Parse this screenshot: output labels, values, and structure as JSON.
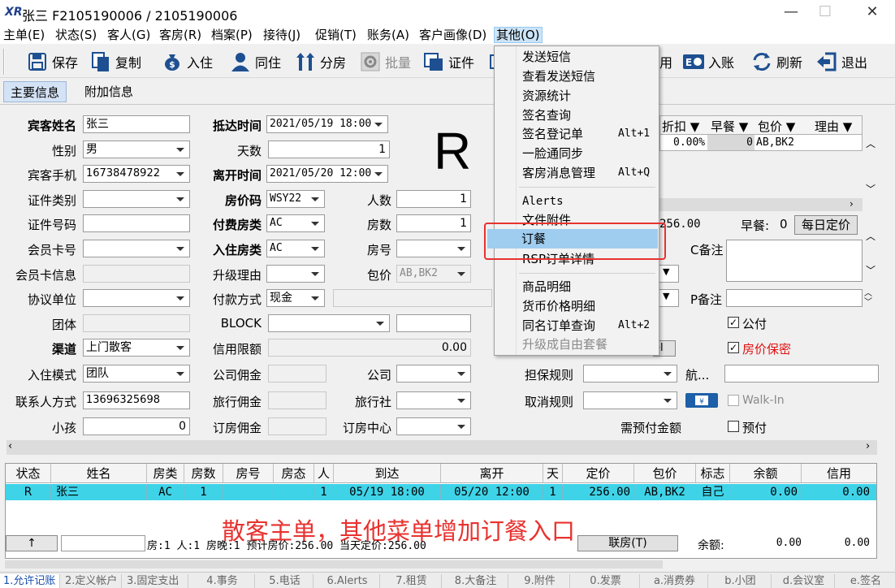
{
  "window": {
    "logo": "XR",
    "title": "张三  F2105190006 / 2105190006",
    "min": "—",
    "max": "☐",
    "close": "✕"
  },
  "menu": [
    "主单(E)",
    "状态(S)",
    "客人(G)",
    "客房(R)",
    "档案(P)",
    "接待(J)",
    "促销(T)",
    "账务(A)",
    "客户画像(D)",
    "其他(O)"
  ],
  "toolbar": {
    "save": "保存",
    "copy": "复制",
    "checkin": "入住",
    "cohabit": "同住",
    "split_room": "分房",
    "batch": "批量",
    "certificate": "证件",
    "post": "用",
    "post_account": "入账",
    "refresh": "刷新",
    "exit": "退出"
  },
  "tabs": {
    "main": "主要信息",
    "extra": "附加信息"
  },
  "status_letter": "R",
  "form": {
    "guest_name_label": "宾客姓名",
    "guest_name": "张三",
    "gender_label": "性别",
    "gender": "男",
    "mobile_label": "宾客手机",
    "mobile": "16738478922",
    "id_type_label": "证件类别",
    "id_type": "",
    "id_no_label": "证件号码",
    "id_no": "",
    "member_card_label": "会员卡号",
    "member_card": "",
    "member_info_label": "会员卡信息",
    "agreement_label": "协议单位",
    "group_label": "团体",
    "channel_label": "渠道",
    "channel": "上门散客",
    "checkin_mode_label": "入住模式",
    "checkin_mode": "团队",
    "contact_label": "联系人方式",
    "contact": "13696325698",
    "child_label": "小孩",
    "child": "0",
    "arrival_label": "抵达时间",
    "arrival": "2021/05/19 18:00",
    "nights_label": "天数",
    "nights": "1",
    "departure_label": "离开时间",
    "departure": "2021/05/20 12:00",
    "rate_code_label": "房价码",
    "rate_code": "WSY22",
    "paid_type_label": "付费房类",
    "paid_type": "AC",
    "room_type_label": "入住房类",
    "room_type": "AC",
    "upgrade_label": "升级理由",
    "pay_method_label": "付款方式",
    "pay_method": "现金",
    "block_label": "BLOCK",
    "credit_label": "信用限额",
    "credit": "0.00",
    "company_comm_label": "公司佣金",
    "agency_comm_label": "旅行佣金",
    "booking_comm_label": "订房佣金",
    "persons_label": "人数",
    "persons": "1",
    "rooms_label": "房数",
    "rooms": "1",
    "room_no_label": "房号",
    "package_label": "包价",
    "package": "AB,BK2",
    "company_label": "公司",
    "agency_label": "旅行社",
    "booking_center_label": "订房中心"
  },
  "right_panel": {
    "cols": [
      "折扣",
      "早餐",
      "包价",
      "理由"
    ],
    "discount": "0.00%",
    "breakfast": "0",
    "package": "AB,BK2",
    "price": "256.00",
    "breakfast_label": "早餐:",
    "breakfast_value": "0",
    "daily_rate_button": "每日定价",
    "c_note_label": "C备注",
    "p_note_label": "P备注",
    "public_label": "公付",
    "price_secret_label": "房价保密",
    "guarantee_label": "担保规则",
    "flight_label": "航...",
    "cancel_label": "取消规则",
    "walkin_label": "Walk-In",
    "deposit_label": "需预付金额",
    "prepay_label": "预付",
    "el_fragment": "el"
  },
  "dropdown": {
    "items": [
      {
        "label": "发送短信",
        "shortcut": ""
      },
      {
        "label": "查看发送短信",
        "shortcut": ""
      },
      {
        "label": "资源统计",
        "shortcut": ""
      },
      {
        "label": "签名查询",
        "shortcut": ""
      },
      {
        "label": "签名登记单",
        "shortcut": "Alt+1"
      },
      {
        "label": "一脸通同步",
        "shortcut": ""
      },
      {
        "label": "客房消息管理",
        "shortcut": "Alt+Q"
      },
      {
        "label": "Alerts",
        "shortcut": ""
      },
      {
        "label": "文件附件",
        "shortcut": ""
      },
      {
        "label": "订餐",
        "shortcut": ""
      },
      {
        "label": "RSP订单详情",
        "shortcut": ""
      },
      {
        "label": "商品明细",
        "shortcut": ""
      },
      {
        "label": "货币价格明细",
        "shortcut": ""
      },
      {
        "label": "同名订单查询",
        "shortcut": "Alt+2"
      },
      {
        "label": "升级成自由套餐",
        "shortcut": ""
      }
    ]
  },
  "grid": {
    "headers": [
      "状态",
      "姓名",
      "房类",
      "房数",
      "房号",
      "房态",
      "人",
      "到达",
      "离开",
      "天",
      "定价",
      "包价",
      "标志",
      "余额",
      "信用"
    ],
    "row": [
      "R",
      "张三",
      "AC",
      "1",
      "",
      "",
      "1",
      "05/19 18:00",
      "05/20 12:00",
      "1",
      "256.00",
      "AB,BK2",
      "自己",
      "0.00",
      "0.00"
    ],
    "footer": {
      "arrow": "↑",
      "summary": "房:1  人:1  房晚:1  预计房价:256.00  当天定价:256.00",
      "link_room": "联房(T)",
      "balance_label": "余额:",
      "balance": "0.00",
      "credit": "0.00"
    }
  },
  "annotation": "散客主单，其他菜单增加订餐入口",
  "status_tabs": [
    "1.允许记账",
    "2.定义帐户",
    "3.固定支出",
    "4.事务",
    "5.电话",
    "6.Alerts",
    "7.租赁",
    "8.大备注",
    "9.附件",
    "0.发票",
    "a.消费券",
    "b.小团",
    "d.会议室",
    "e.签名"
  ]
}
